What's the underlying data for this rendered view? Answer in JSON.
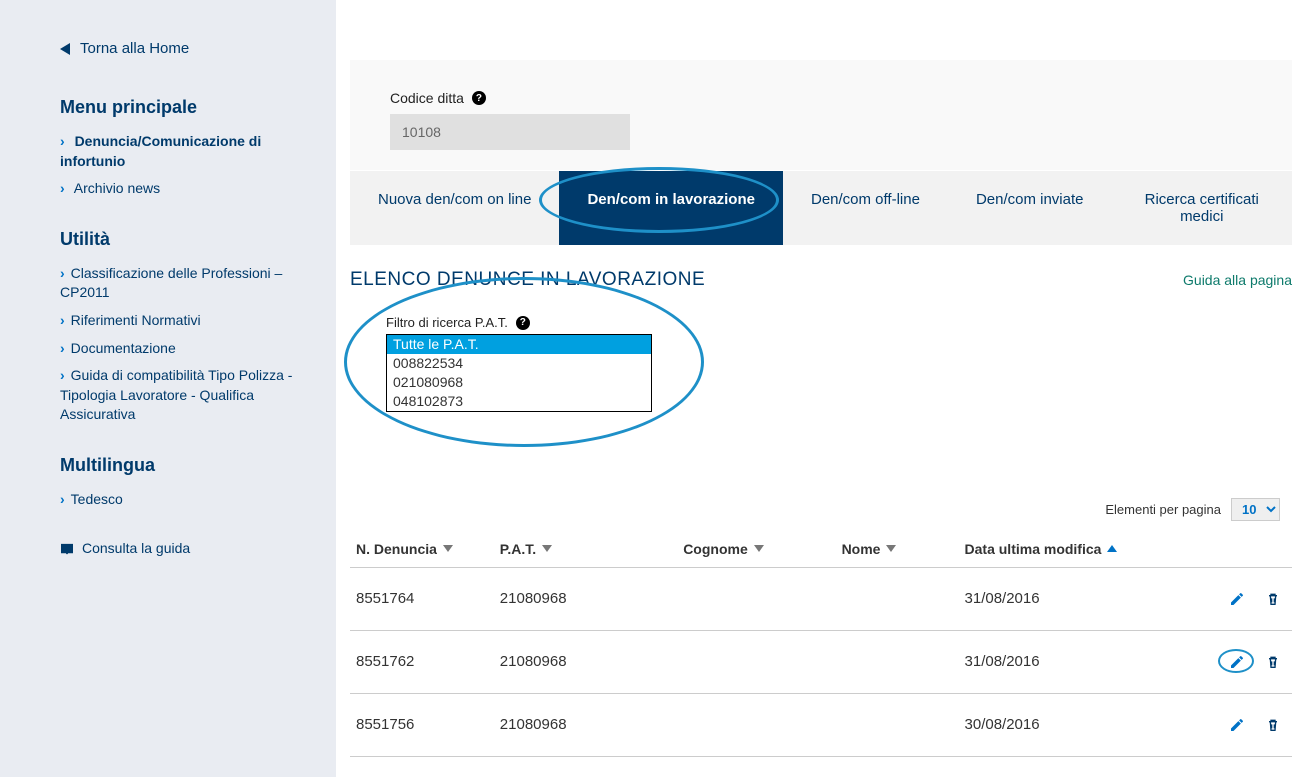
{
  "sidebar": {
    "back_label": "Torna alla Home",
    "menu_principale_heading": "Menu principale",
    "menu_principale_items": [
      {
        "label": "Denuncia/Comunicazione di infortunio",
        "active": true
      },
      {
        "label": "Archivio news",
        "active": false
      }
    ],
    "utilita_heading": "Utilità",
    "utilita_items": [
      {
        "label": "Classificazione delle Professioni – CP2011"
      },
      {
        "label": "Riferimenti Normativi"
      },
      {
        "label": "Documentazione"
      },
      {
        "label": "Guida di compatibilità Tipo Polizza - Tipologia Lavoratore - Qualifica Assicurativa"
      }
    ],
    "multilingua_heading": "Multilingua",
    "multilingua_items": [
      {
        "label": "Tedesco"
      }
    ],
    "consulta_guida": "Consulta la guida"
  },
  "company": {
    "label": "Codice ditta",
    "value": "10108"
  },
  "tabs": [
    {
      "label": "Nuova den/com on line",
      "active": false
    },
    {
      "label": "Den/com in lavorazione",
      "active": true
    },
    {
      "label": "Den/com off-line",
      "active": false
    },
    {
      "label": "Den/com inviate",
      "active": false
    },
    {
      "label": "Ricerca certificati medici",
      "active": false
    }
  ],
  "section": {
    "title": "ELENCO DENUNCE IN LAVORAZIONE",
    "guide_link": "Guida alla pagina"
  },
  "filter": {
    "label": "Filtro di ricerca P.A.T.",
    "options": [
      {
        "label": "Tutte le P.A.T.",
        "selected": true
      },
      {
        "label": "008822534",
        "selected": false
      },
      {
        "label": "021080968",
        "selected": false
      },
      {
        "label": "048102873",
        "selected": false
      }
    ]
  },
  "pager": {
    "label": "Elementi per pagina",
    "value": "10"
  },
  "table": {
    "headers": {
      "denuncia": "N. Denuncia",
      "pat": "P.A.T.",
      "cognome": "Cognome",
      "nome": "Nome",
      "data": "Data ultima modifica"
    },
    "rows": [
      {
        "denuncia": "8551764",
        "pat": "21080968",
        "cognome": "",
        "nome": "",
        "data": "31/08/2016",
        "highlight_edit": false
      },
      {
        "denuncia": "8551762",
        "pat": "21080968",
        "cognome": "",
        "nome": "",
        "data": "31/08/2016",
        "highlight_edit": true
      },
      {
        "denuncia": "8551756",
        "pat": "21080968",
        "cognome": "",
        "nome": "",
        "data": "30/08/2016",
        "highlight_edit": false
      }
    ]
  },
  "colors": {
    "brand": "#003a6b",
    "accent": "#0072c6",
    "annotate": "#1e90c8",
    "guide": "#0d7a6b"
  }
}
